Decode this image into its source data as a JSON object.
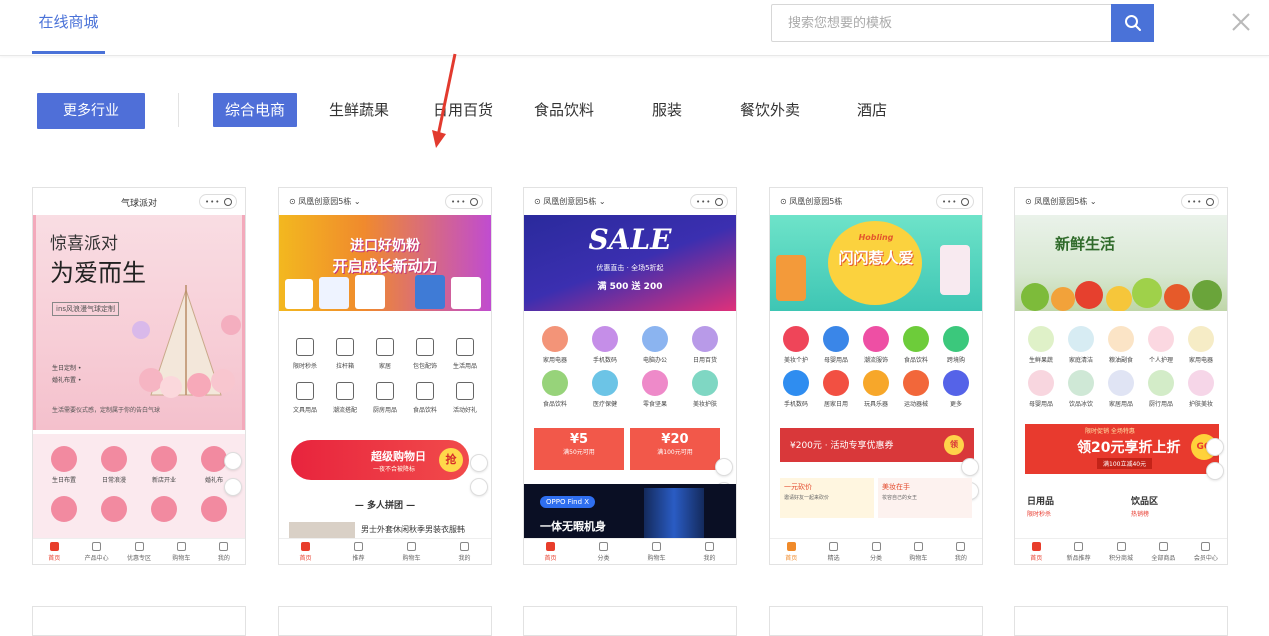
{
  "header": {
    "brand_tab": "在线商城",
    "search_placeholder": "搜索您想要的模板"
  },
  "filters": {
    "more_label": "更多行业",
    "categories": [
      {
        "label": "综合电商",
        "active": true
      },
      {
        "label": "生鲜蔬果",
        "active": false
      },
      {
        "label": "日用百货",
        "active": false
      },
      {
        "label": "食品饮料",
        "active": false
      },
      {
        "label": "服装",
        "active": false
      },
      {
        "label": "餐饮外卖",
        "active": false
      },
      {
        "label": "酒店",
        "active": false
      }
    ]
  },
  "cards": [
    {
      "head_title": "气球派对",
      "banner_lines": [
        "惊喜派对",
        "为爱而生",
        "ins风浪漫气球定制",
        "生日定制 •",
        "婚礼布置 •",
        "生活需要仪式感，定制属于你的告白气球"
      ],
      "icons": [
        "生日布置",
        "日常浪漫",
        "新店开业",
        "婚礼布",
        "",
        "",
        "",
        ""
      ],
      "tabs": [
        "首页",
        "产品中心",
        "优惠专区",
        "购物车",
        "我的"
      ]
    },
    {
      "head_location": "凤凰创意园5栋",
      "banner_lines": [
        "进口好奶粉",
        "开启成长新动力"
      ],
      "icons": [
        "限时秒杀",
        "拉杆箱",
        "家居",
        "包包配饰",
        "生活用品",
        "文具用品",
        "潮流搭配",
        "厨房用品",
        "食品饮料",
        "活动好礼"
      ],
      "promo_text": "超级购物日",
      "promo_sub": "一夜不合被降标",
      "promo_btn": "抢",
      "section_title": "— 多人拼团 —",
      "group_item": "男士外套休闲秋季男装衣服韩",
      "tabs": [
        "首页",
        "推荐",
        "购物车",
        "我的"
      ]
    },
    {
      "head_location": "凤凰创意园5栋",
      "banner_lines": [
        "SALE",
        "优惠直击 · 全场5折起",
        "满 500 送 200"
      ],
      "icons": [
        "家用电器",
        "手机数码",
        "电脑办公",
        "日用百货",
        "食品饮料",
        "医疗保健",
        "零食坚果",
        "美妆护肤"
      ],
      "coupons": [
        "¥5",
        "¥20"
      ],
      "coupon_sub": [
        "满50元可用",
        "满100元可用"
      ],
      "phone_badge": "OPPO Find X",
      "phone_text": "一体无暇机身",
      "tabs": [
        "首页",
        "分类",
        "购物车",
        "我的"
      ]
    },
    {
      "head_location": "凤凰创意园5栋",
      "banner_lines": [
        "Hobling",
        "闪闪惹人爱"
      ],
      "icons": [
        "美妆个护",
        "母婴用品",
        "潮流服饰",
        "食品饮料",
        "跨境购",
        "手机数码",
        "居家日用",
        "玩具乐器",
        "运动器械",
        "更多"
      ],
      "coupon_main": "¥200元 · 活动专享优惠券",
      "coupon_btn": "领",
      "goods": [
        "一元砍价",
        "邀请好友一起来砍价",
        "美妆在手",
        "妆容自己的女王"
      ],
      "tabs": [
        "首页",
        "精选",
        "分类",
        "购物车",
        "我的"
      ]
    },
    {
      "head_location": "凤凰创意园5栋",
      "banner_lines": [
        "新鲜生活"
      ],
      "icons": [
        "生鲜果蔬",
        "家庭清洁",
        "粮油副食",
        "个人护理",
        "家用电器",
        "母婴用品",
        "饮品冰饮",
        "家居用品",
        "厨行用品",
        "护肤美妆"
      ],
      "promo_top": "限时促销 全场特惠",
      "promo_main": "领20元享折上折",
      "promo_sub": "满100立减40元",
      "promo_go": "GO",
      "sections": [
        "日用品",
        "限时秒杀",
        "饮品区",
        "热销榜"
      ],
      "tabs": [
        "首页",
        "新品推荐",
        "积分商城",
        "全部商品",
        "会员中心"
      ]
    }
  ],
  "colors": {
    "accent": "#4f6fd8",
    "brand_tab": "#4a72d8",
    "red": "#e83d2b"
  }
}
